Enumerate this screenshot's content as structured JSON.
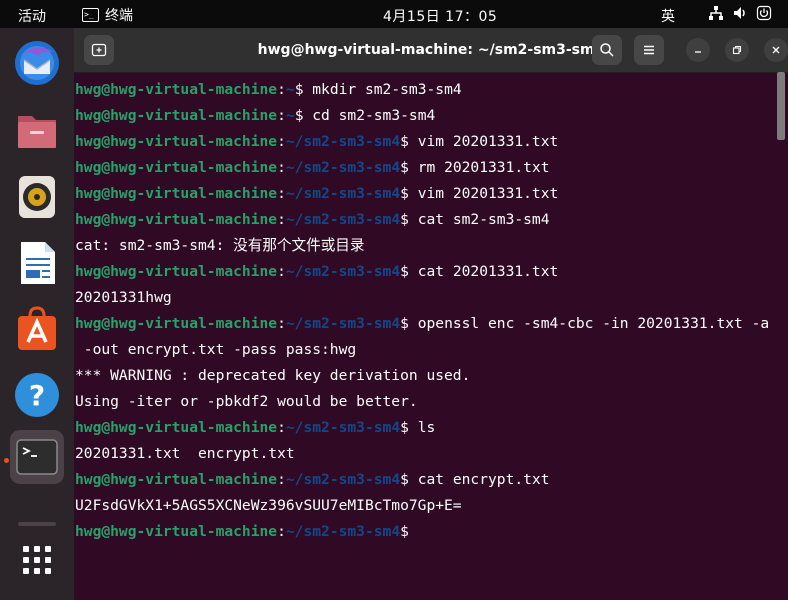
{
  "topbar": {
    "activities": "活动",
    "app_name": "终端",
    "clock": "4月15日  17：05",
    "input_method": "英"
  },
  "dock": {
    "items": [
      "thunderbird-icon",
      "files-icon",
      "rhythmbox-icon",
      "libreoffice-writer-icon",
      "app-center-icon",
      "help-icon",
      "terminal-icon",
      "show-apps-icon"
    ]
  },
  "window": {
    "title": "hwg@hwg-virtual-machine: ~/sm2-sm3-sm4"
  },
  "terminal": {
    "user": "hwg@hwg-virtual-machine",
    "lines": [
      {
        "type": "prompt",
        "path": "~",
        "cmd": " mkdir sm2-sm3-sm4"
      },
      {
        "type": "prompt",
        "path": "~",
        "cmd": " cd sm2-sm3-sm4"
      },
      {
        "type": "prompt",
        "path": "~/sm2-sm3-sm4",
        "cmd": " vim 20201331.txt"
      },
      {
        "type": "prompt",
        "path": "~/sm2-sm3-sm4",
        "cmd": " rm 20201331.txt"
      },
      {
        "type": "prompt",
        "path": "~/sm2-sm3-sm4",
        "cmd": " vim 20201331.txt"
      },
      {
        "type": "prompt",
        "path": "~/sm2-sm3-sm4",
        "cmd": " cat sm2-sm3-sm4"
      },
      {
        "type": "output",
        "text": "cat: sm2-sm3-sm4: 没有那个文件或目录"
      },
      {
        "type": "prompt",
        "path": "~/sm2-sm3-sm4",
        "cmd": " cat 20201331.txt"
      },
      {
        "type": "output",
        "text": "20201331hwg"
      },
      {
        "type": "prompt",
        "path": "~/sm2-sm3-sm4",
        "cmd": " openssl enc -sm4-cbc -in 20201331.txt -a"
      },
      {
        "type": "output",
        "text": " -out encrypt.txt -pass pass:hwg"
      },
      {
        "type": "output",
        "text": "*** WARNING : deprecated key derivation used."
      },
      {
        "type": "output",
        "text": "Using -iter or -pbkdf2 would be better."
      },
      {
        "type": "prompt",
        "path": "~/sm2-sm3-sm4",
        "cmd": " ls"
      },
      {
        "type": "output",
        "text": "20201331.txt  encrypt.txt"
      },
      {
        "type": "prompt",
        "path": "~/sm2-sm3-sm4",
        "cmd": " cat encrypt.txt"
      },
      {
        "type": "output",
        "text": "U2FsdGVkX1+5AGS5XCNeWz396vSUU7eMIBcTmo7Gp+E="
      },
      {
        "type": "prompt",
        "path": "~/sm2-sm3-sm4",
        "cmd": ""
      }
    ]
  },
  "colors": {
    "terminal_bg": "#300a24",
    "user_green": "#26a269",
    "path_blue": "#12488b",
    "headerbar": "#303030",
    "dock_bg": "#2b2529",
    "running_indicator": "#e9531a"
  }
}
